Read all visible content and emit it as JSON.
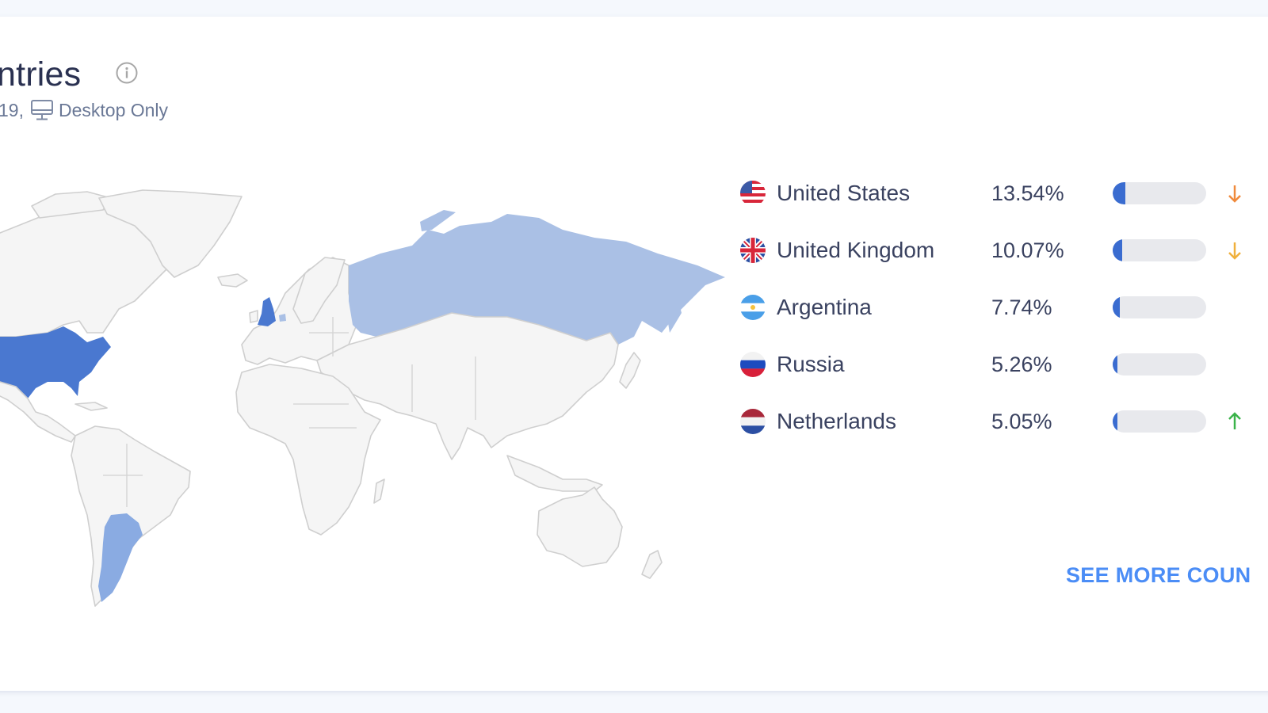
{
  "header": {
    "title": "ntries",
    "subtitle_date": "19,",
    "subtitle_device": "Desktop Only"
  },
  "colors": {
    "accent": "#3a6cd0",
    "link": "#4b8df6",
    "map_dark": "#4a78d0",
    "map_mid": "#8aabe2",
    "map_light": "#aac0e5",
    "trend_up": "#3bb34a",
    "trend_down": "#f08a3c"
  },
  "countries": [
    {
      "name": "United States",
      "share": "13.54%",
      "share_value": 13.54,
      "flag": "us-flag",
      "trend": "down",
      "map_shade": "dark"
    },
    {
      "name": "United Kingdom",
      "share": "10.07%",
      "share_value": 10.07,
      "flag": "uk-flag",
      "trend": "down",
      "map_shade": "dark"
    },
    {
      "name": "Argentina",
      "share": "7.74%",
      "share_value": 7.74,
      "flag": "argentina-flag",
      "trend": "none",
      "map_shade": "mid"
    },
    {
      "name": "Russia",
      "share": "5.26%",
      "share_value": 5.26,
      "flag": "russia-flag",
      "trend": "none",
      "map_shade": "light"
    },
    {
      "name": "Netherlands",
      "share": "5.05%",
      "share_value": 5.05,
      "flag": "netherlands-flag",
      "trend": "up",
      "map_shade": "light"
    }
  ],
  "see_more_label": "SEE MORE COUN"
}
